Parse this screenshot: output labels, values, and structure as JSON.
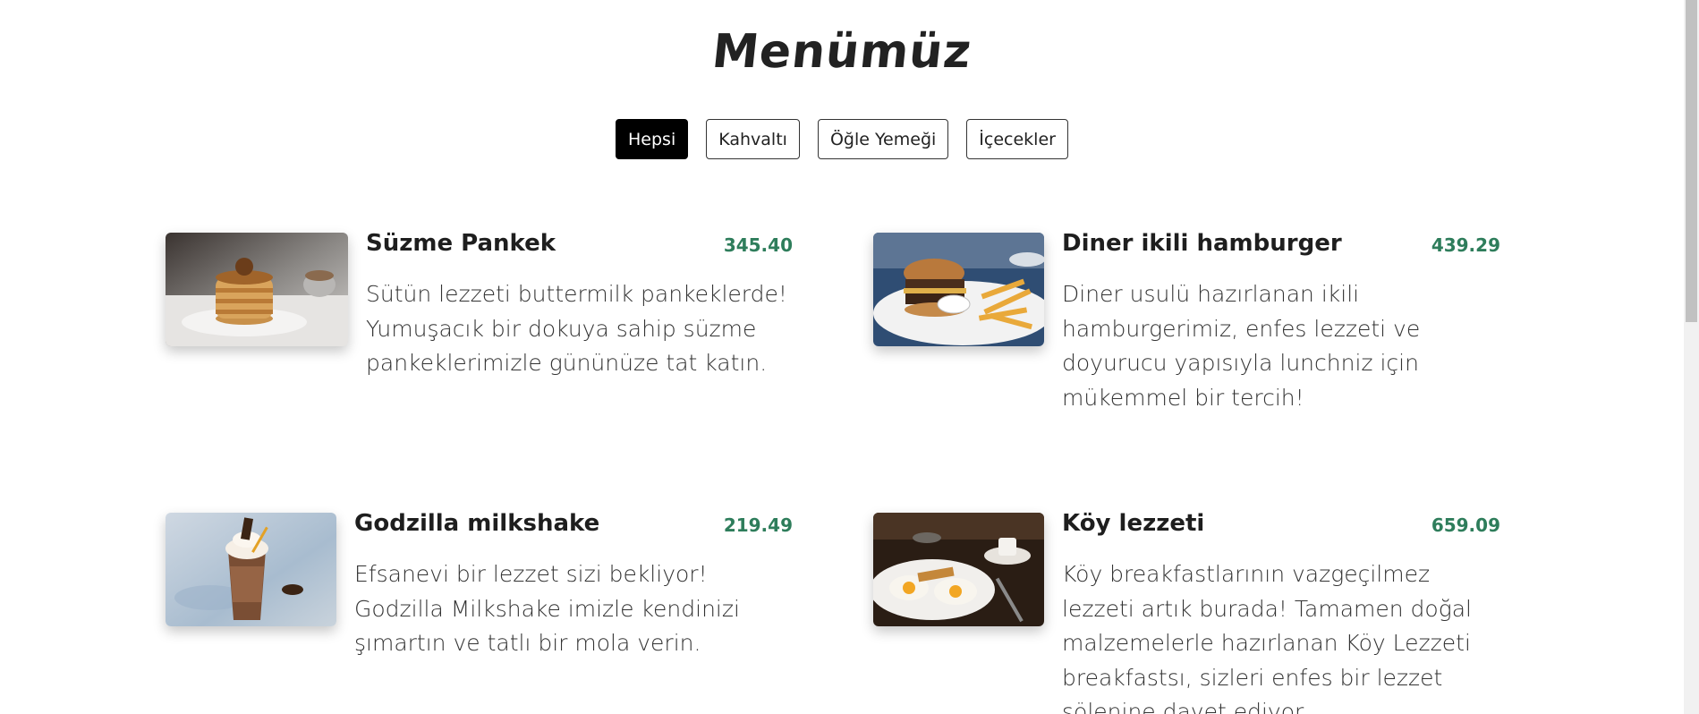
{
  "page": {
    "title": "Menümüz"
  },
  "filters": [
    {
      "label": "Hepsi",
      "active": true
    },
    {
      "label": "Kahvaltı",
      "active": false
    },
    {
      "label": "Öğle Yemeği",
      "active": false
    },
    {
      "label": "İçecekler",
      "active": false
    }
  ],
  "items": [
    {
      "name": "Süzme Pankek",
      "price": "345.40",
      "description": "Sütün lezzeti buttermilk pankeklerde! Yumuşacık bir dokuya sahip süzme pankeklerimizle gününüze tat katın.",
      "image": "pancake-photo"
    },
    {
      "name": "Diner ikili hamburger",
      "price": "439.29",
      "description": "Diner usulü hazırlanan ikili hamburgerimiz, enfes lezzeti ve doyurucu yapısıyla lunchniz için mükemmel bir tercih!",
      "image": "hamburger-photo"
    },
    {
      "name": "Godzilla milkshake",
      "price": "219.49",
      "description": "Efsanevi bir lezzet sizi bekliyor! Godzilla Milkshake imizle kendinizi şımartın ve tatlı bir mola verin.",
      "image": "milkshake-photo"
    },
    {
      "name": "Köy lezzeti",
      "price": "659.09",
      "description": "Köy breakfastlarının vazgeçilmez lezzeti artık burada! Tamamen doğal malzemelerle hazırlanan Köy Lezzeti breakfastsı, sizleri enfes bir lezzet şölenine davet ediyor.",
      "image": "breakfast-photo"
    }
  ],
  "colors": {
    "price": "#2e7d5b",
    "active_filter_bg": "#000000",
    "text": "#212529"
  }
}
